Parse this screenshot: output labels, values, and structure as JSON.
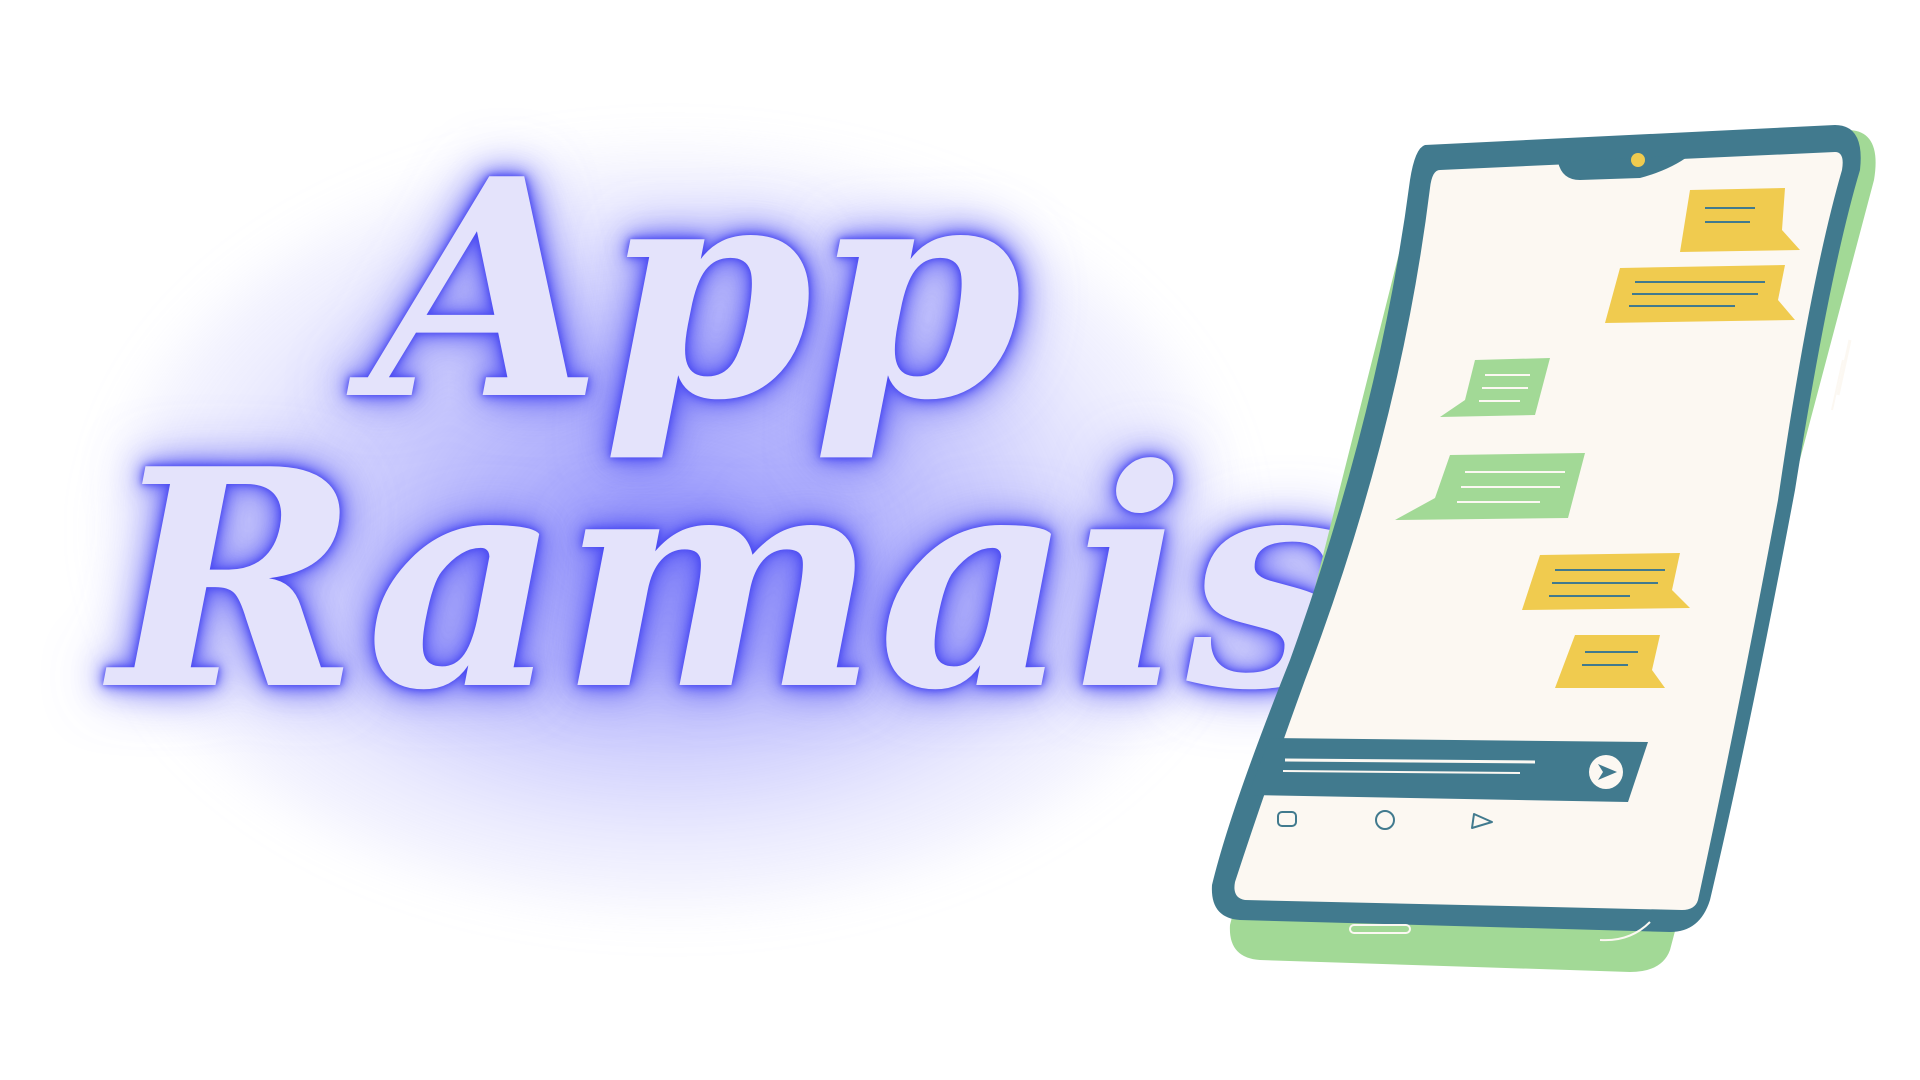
{
  "title": {
    "line1": "App",
    "line2": "Ramais"
  },
  "colors": {
    "glow": "#4b4bf2",
    "title_fill": "#e4e3fb",
    "phone_frame": "#417a8e",
    "phone_shadow": "#a2d996",
    "screen": "#fcf8f2",
    "bubble_yellow": "#f0cb4f",
    "bubble_green": "#a2d996",
    "camera": "#f0cb4f"
  },
  "icons": [
    "back-icon",
    "home-icon",
    "recent-apps-icon",
    "send-icon"
  ]
}
